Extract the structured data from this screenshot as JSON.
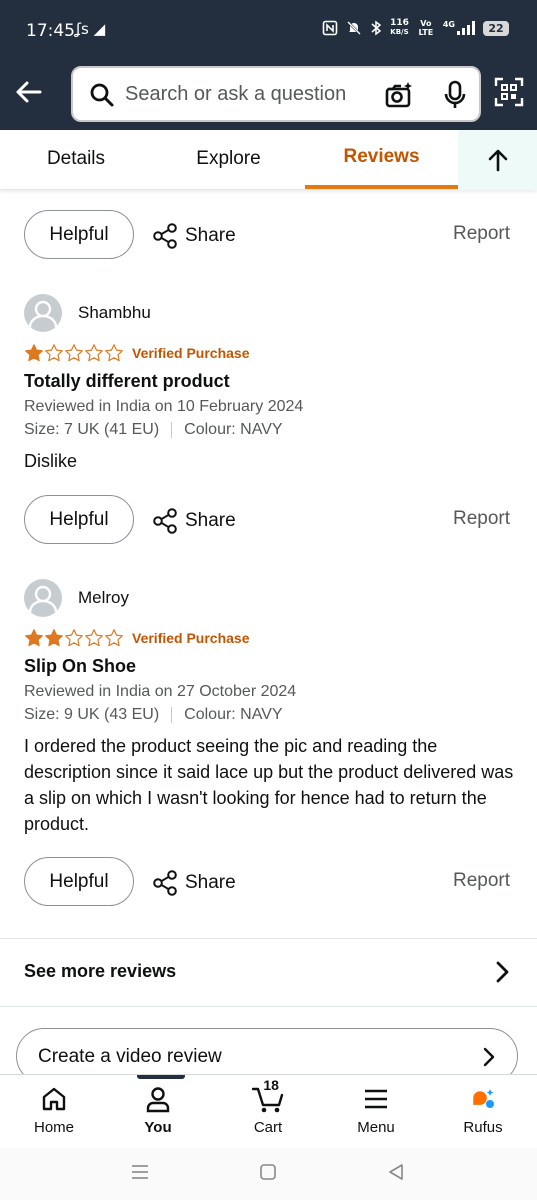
{
  "status_bar": {
    "time": "17:45",
    "notif_icons": "ʆs ◢",
    "speed_value": "116",
    "speed_unit": "KB/S",
    "volte": "Vo LTE",
    "network": "4G",
    "battery": "22"
  },
  "header": {
    "search_placeholder": "Search or ask a question"
  },
  "tabs": [
    {
      "label": "Details"
    },
    {
      "label": "Explore"
    },
    {
      "label": "Reviews",
      "active": true
    }
  ],
  "review_actions": {
    "helpful_label": "Helpful",
    "share_label": "Share",
    "report_label": "Report"
  },
  "reviews": [
    {
      "author": "Shambhu",
      "rating": 1,
      "verified": "Verified Purchase",
      "title": "Totally different product",
      "date": "Reviewed in India on 10 February 2024",
      "size": "Size: 7 UK (41 EU)",
      "colour": "Colour: NAVY",
      "body": "Dislike"
    },
    {
      "author": "Melroy",
      "rating": 2,
      "verified": "Verified Purchase",
      "title": "Slip On Shoe",
      "date": "Reviewed in India on 27 October 2024",
      "size": "Size: 9 UK (43 EU)",
      "colour": "Colour: NAVY",
      "body": "I ordered the product seeing the pic and reading the description since it said lace up but the product delivered was a slip on which I wasn't looking for hence had to return the product."
    }
  ],
  "see_more_reviews": "See more reviews",
  "create_video_review": "Create a video review",
  "bottom_nav": [
    {
      "label": "Home"
    },
    {
      "label": "You",
      "active": true
    },
    {
      "label": "Cart",
      "count": "18"
    },
    {
      "label": "Menu"
    },
    {
      "label": "Rufus"
    }
  ],
  "colors": {
    "header_bg": "#232f3e",
    "accent_orange": "#c45500",
    "tab_underline": "#e47911",
    "star_orange": "#de7921",
    "rufus_orange": "#ff6f00",
    "rufus_blue": "#1a98ff"
  }
}
